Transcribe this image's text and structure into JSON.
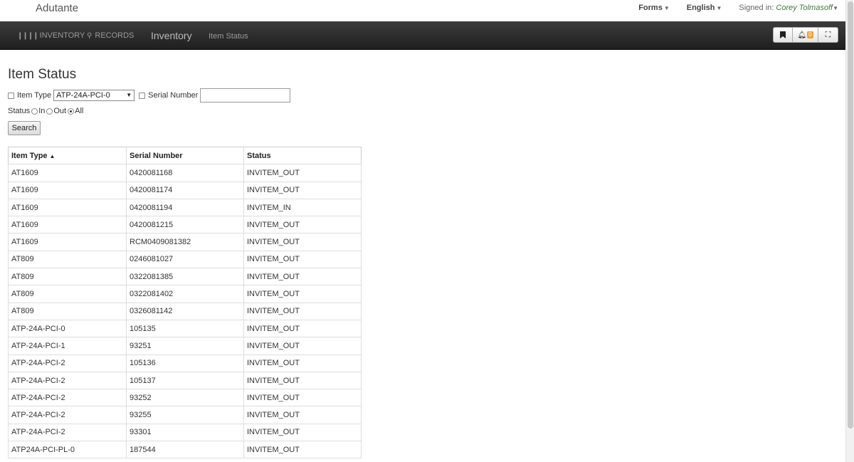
{
  "header": {
    "brand": "Adutante",
    "forms_label": "Forms",
    "language_label": "English",
    "signed_in_label": "Signed in:",
    "user_name": "Corey Tolmasoff"
  },
  "navbar": {
    "inventory_label": "INVENTORY",
    "records_label": "RECORDS",
    "section_title": "Inventory",
    "page_label": "Item Status",
    "alert_count": "0"
  },
  "page": {
    "title": "Item Status",
    "item_type_label": "Item Type",
    "item_type_value": "ATP-24A-PCI-0",
    "serial_number_label": "Serial Number",
    "serial_number_value": "",
    "status_label": "Status",
    "status_options": [
      "In",
      "Out",
      "All"
    ],
    "status_selected": "All",
    "search_label": "Search"
  },
  "table": {
    "columns": [
      "Item Type",
      "Serial Number",
      "Status"
    ],
    "sort_indicator": "▲",
    "rows": [
      [
        "AT1609",
        "0420081168",
        "INVITEM_OUT"
      ],
      [
        "AT1609",
        "0420081174",
        "INVITEM_OUT"
      ],
      [
        "AT1609",
        "0420081194",
        "INVITEM_IN"
      ],
      [
        "AT1609",
        "0420081215",
        "INVITEM_OUT"
      ],
      [
        "AT1609",
        "RCM0409081382",
        "INVITEM_OUT"
      ],
      [
        "AT809",
        "0246081027",
        "INVITEM_OUT"
      ],
      [
        "AT809",
        "0322081385",
        "INVITEM_OUT"
      ],
      [
        "AT809",
        "0322081402",
        "INVITEM_OUT"
      ],
      [
        "AT809",
        "0326081142",
        "INVITEM_OUT"
      ],
      [
        "ATP-24A-PCI-0",
        "105135",
        "INVITEM_OUT"
      ],
      [
        "ATP-24A-PCI-1",
        "93251",
        "INVITEM_OUT"
      ],
      [
        "ATP-24A-PCI-2",
        "105136",
        "INVITEM_OUT"
      ],
      [
        "ATP-24A-PCI-2",
        "105137",
        "INVITEM_OUT"
      ],
      [
        "ATP-24A-PCI-2",
        "93252",
        "INVITEM_OUT"
      ],
      [
        "ATP-24A-PCI-2",
        "93255",
        "INVITEM_OUT"
      ],
      [
        "ATP-24A-PCI-2",
        "93301",
        "INVITEM_OUT"
      ],
      [
        "ATP24A-PCI-PL-0",
        "187544",
        "INVITEM_OUT"
      ]
    ]
  },
  "icons": {
    "inventory": "barcode-icon",
    "records": "search-icon",
    "bookmark": "bookmark-icon",
    "alerts": "bell-icon",
    "fullscreen": "fullscreen-icon"
  }
}
